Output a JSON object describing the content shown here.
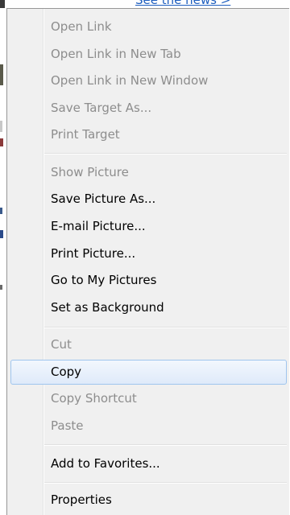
{
  "background": {
    "link_text": "See the news >"
  },
  "context_menu": {
    "items": [
      {
        "label": "Open Link",
        "enabled": false
      },
      {
        "label": "Open Link in New Tab",
        "enabled": false
      },
      {
        "label": "Open Link in New Window",
        "enabled": false
      },
      {
        "label": "Save Target As...",
        "enabled": false
      },
      {
        "label": "Print Target",
        "enabled": false
      },
      {
        "label": "Show Picture",
        "enabled": false
      },
      {
        "label": "Save Picture As...",
        "enabled": true
      },
      {
        "label": "E-mail Picture...",
        "enabled": true
      },
      {
        "label": "Print Picture...",
        "enabled": true
      },
      {
        "label": "Go to My Pictures",
        "enabled": true
      },
      {
        "label": "Set as Background",
        "enabled": true
      },
      {
        "label": "Cut",
        "enabled": false
      },
      {
        "label": "Copy",
        "enabled": true,
        "highlighted": true
      },
      {
        "label": "Copy Shortcut",
        "enabled": false
      },
      {
        "label": "Paste",
        "enabled": false
      },
      {
        "label": "Add to Favorites...",
        "enabled": true
      },
      {
        "label": "Properties",
        "enabled": true
      }
    ]
  },
  "colors": {
    "menu_background": "#f0f0f0",
    "disabled_text": "#8d8d8d",
    "enabled_text": "#000000",
    "highlight_border": "#9fc5ee",
    "link_blue": "#1f5fbf"
  }
}
